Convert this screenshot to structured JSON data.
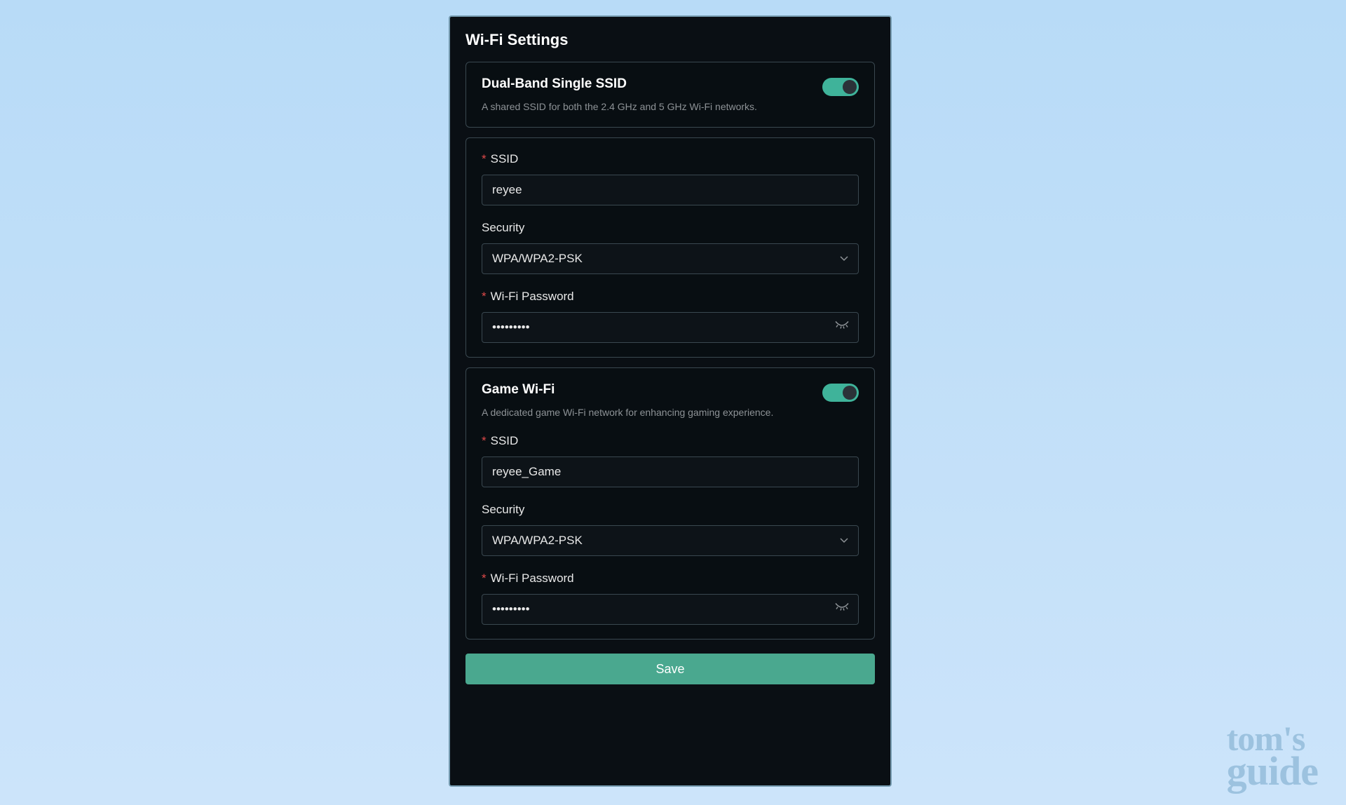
{
  "panel": {
    "title": "Wi-Fi Settings",
    "save_label": "Save"
  },
  "dual_band": {
    "title": "Dual-Band Single SSID",
    "desc": "A shared SSID for both the 2.4 GHz and 5 GHz Wi-Fi networks.",
    "enabled": true
  },
  "main_wifi": {
    "ssid_label": "SSID",
    "ssid_value": "reyee",
    "security_label": "Security",
    "security_value": "WPA/WPA2-PSK",
    "password_label": "Wi-Fi Password",
    "password_value": "•••••••••"
  },
  "game_wifi": {
    "title": "Game Wi-Fi",
    "desc": "A dedicated game Wi-Fi network for enhancing gaming experience.",
    "enabled": true,
    "ssid_label": "SSID",
    "ssid_value": "reyee_Game",
    "security_label": "Security",
    "security_value": "WPA/WPA2-PSK",
    "password_label": "Wi-Fi Password",
    "password_value": "•••••••••"
  },
  "watermark": {
    "line1": "tom's",
    "line2": "guide"
  },
  "colors": {
    "accent": "#3fb39a",
    "panel_bg": "#0a0f14",
    "border": "#3a4850",
    "required": "#e04a4a"
  }
}
